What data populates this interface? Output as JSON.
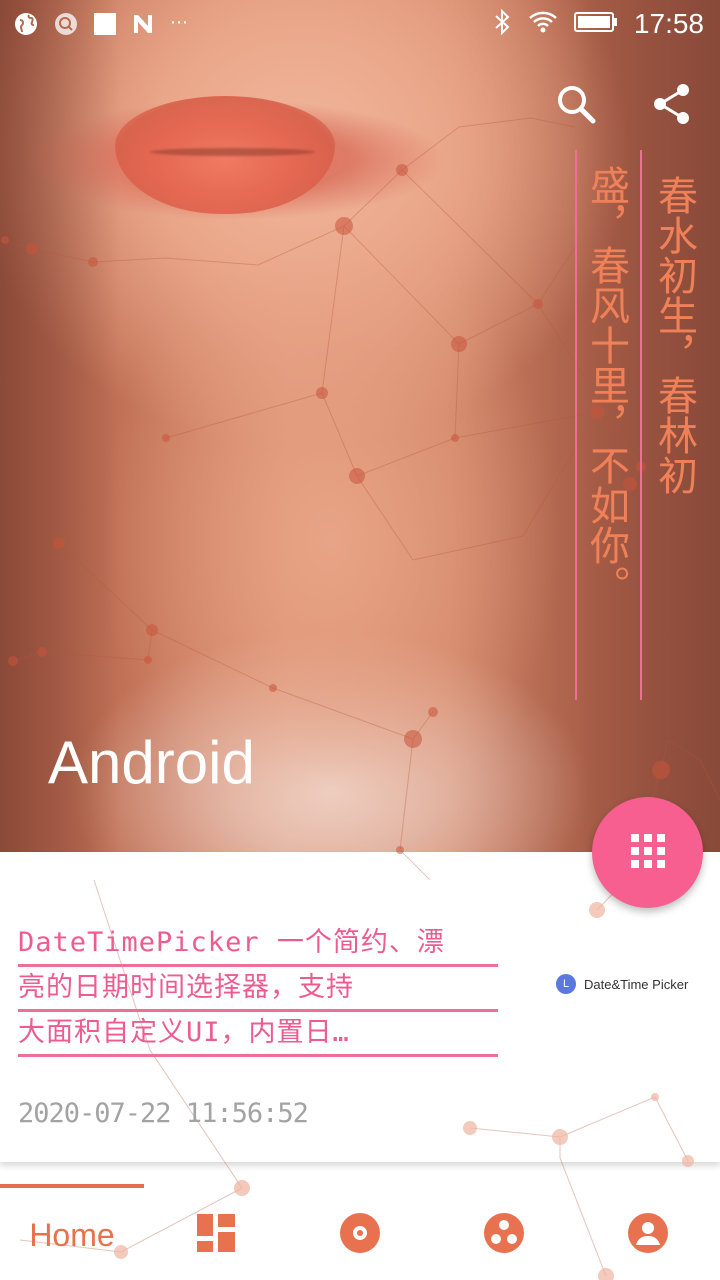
{
  "status_bar": {
    "time": "17:58",
    "left_icons": [
      "globe-icon",
      "search-bubble-icon",
      "square-icon",
      "n-logo-icon",
      "more-dots-icon"
    ],
    "right_icons": [
      "bluetooth-icon",
      "wifi-icon",
      "battery-icon"
    ],
    "more_dots": "⋯"
  },
  "toolbar": {
    "icons": [
      "search-icon",
      "share-icon"
    ]
  },
  "hero": {
    "title": "Android",
    "poem_right": "春水初生，春林初",
    "poem_left": "盛，春风十里，不如你。"
  },
  "card": {
    "title_lines": [
      "DateTimePicker 一个简约、漂",
      "亮的日期时间选择器，支持",
      "大面积自定义UI，内置日…"
    ],
    "badge_icon": "L",
    "badge_text": "Date&Time Picker",
    "date": "2020-07-22 11:56:52"
  },
  "fab": {
    "icon": "grid-icon"
  },
  "bottom_nav": {
    "items": [
      {
        "label": "Home",
        "icon": "home"
      },
      {
        "label": "",
        "icon": "dashboard-icon"
      },
      {
        "label": "",
        "icon": "disc-icon"
      },
      {
        "label": "",
        "icon": "apps-circle-icon"
      },
      {
        "label": "",
        "icon": "account-icon"
      }
    ],
    "selected_index": 0
  },
  "colors": {
    "accent": "#e8714f",
    "pink": "#f75f90",
    "title_pink": "#ee5c8f",
    "poem_orange": "#f08058",
    "date_gray": "#a3a3a3"
  }
}
